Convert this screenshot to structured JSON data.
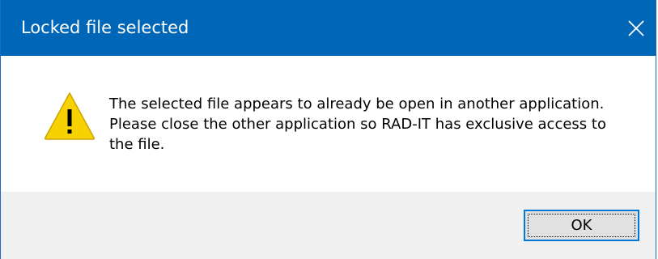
{
  "window": {
    "title": "Locked file selected",
    "titlebar_color": "#0066b8"
  },
  "titlebar": {
    "close_icon": "close-icon"
  },
  "content": {
    "icon": "warning-icon",
    "icon_color": "#f8d200",
    "message": "The selected file appears to already be open in another application. Please close the other application so RAD-IT has exclusive access to the file."
  },
  "footer": {
    "ok_label": "OK",
    "button_accent": "#0078d7"
  }
}
